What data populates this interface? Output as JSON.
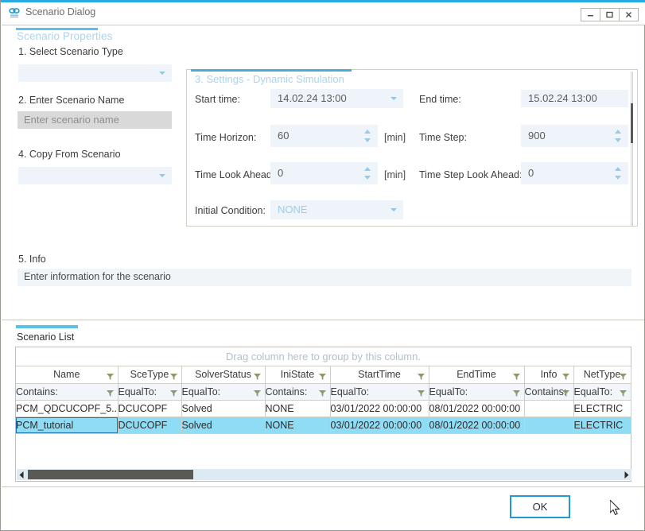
{
  "window": {
    "title": "Scenario Dialog",
    "icon": "link-chain-icon",
    "controls": {
      "minimize": "minimize-icon",
      "maximize": "maximize-icon",
      "close": "close-icon"
    },
    "accent_color": "#29abe2"
  },
  "properties_panel": {
    "title": "Scenario Properties",
    "scenario_type": {
      "label": "1. Select Scenario Type",
      "value": "",
      "placeholder": ""
    },
    "scenario_name": {
      "label": "2. Enter Scenario Name",
      "value": "",
      "placeholder": "Enter scenario name"
    },
    "copy_from": {
      "label": "4. Copy From Scenario",
      "value": "",
      "placeholder": ""
    },
    "info": {
      "label": "5. Info",
      "value": "Enter information for the scenario",
      "placeholder": "Enter information for the scenario"
    }
  },
  "settings_panel": {
    "title": "3. Settings - Dynamic Simulation",
    "fields": {
      "start_time": {
        "label": "Start time:",
        "value": "14.02.24 13:00"
      },
      "end_time": {
        "label": "End time:",
        "value": "15.02.24 13:00"
      },
      "time_horizon": {
        "label": "Time Horizon:",
        "value": "60",
        "unit": "[min]"
      },
      "time_step": {
        "label": "Time Step:",
        "value": "900",
        "unit": ""
      },
      "time_look_ahead": {
        "label": "Time Look Ahead:",
        "value": "0",
        "unit": "[min]"
      },
      "time_step_look_ahead": {
        "label": "Time Step Look Ahead:",
        "value": "0",
        "unit": ""
      },
      "initial_condition": {
        "label": "Initial Condition:",
        "value": "NONE"
      }
    }
  },
  "scenario_list": {
    "tab_label": "Scenario List",
    "group_hint": "Drag column here to group by this column.",
    "columns": [
      {
        "header": "Name",
        "filter": "Contains:"
      },
      {
        "header": "SceType",
        "filter": "EqualTo:"
      },
      {
        "header": "SolverStatus",
        "filter": "EqualTo:"
      },
      {
        "header": "IniState",
        "filter": "Contains:"
      },
      {
        "header": "StartTime",
        "filter": "EqualTo:"
      },
      {
        "header": "EndTime",
        "filter": "EqualTo:"
      },
      {
        "header": "Info",
        "filter": "Contains:"
      },
      {
        "header": "NetType",
        "filter": "EqualTo:"
      }
    ],
    "rows": [
      {
        "selected": false,
        "cells": [
          "PCM_QDCUCOPF_5...",
          "DCUCOPF",
          "Solved",
          "NONE",
          "03/01/2022 00:00:00",
          "08/01/2022 00:00:00",
          "",
          "ELECTRIC"
        ]
      },
      {
        "selected": true,
        "cells": [
          "PCM_tutorial",
          "DCUCOPF",
          "Solved",
          "NONE",
          "03/01/2022 00:00:00",
          "08/01/2022 00:00:00",
          "",
          "ELECTRIC"
        ]
      }
    ]
  },
  "footer": {
    "ok_label": "OK"
  }
}
